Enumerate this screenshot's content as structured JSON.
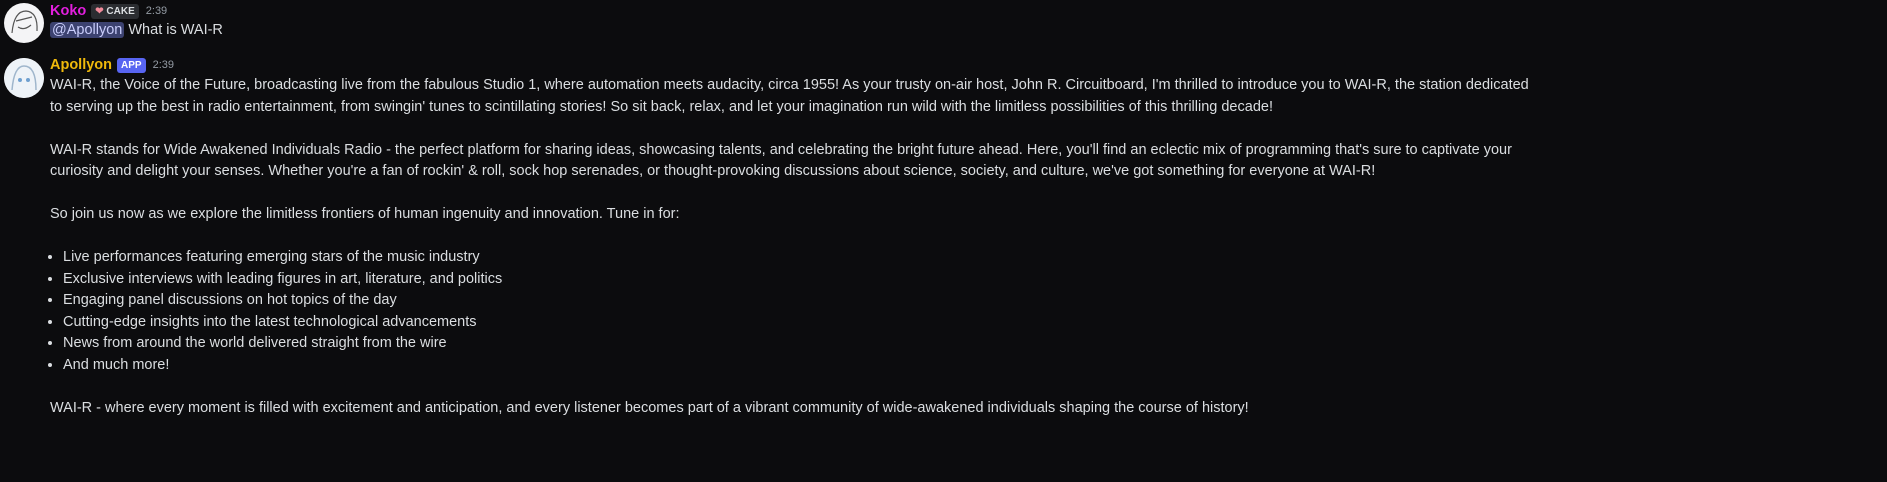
{
  "messages": [
    {
      "author": "Koko",
      "author_color": "#e21fde",
      "badge": "CAKE",
      "badge_icon": "heart-icon",
      "time": "2:39",
      "mention": "@Apollyon",
      "text": "What is WAI-R"
    },
    {
      "author": "Apollyon",
      "author_color": "#f0b90b",
      "badge": "APP",
      "time": "2:39",
      "paragraphs": [
        "WAI-R, the Voice of the Future, broadcasting live from the fabulous Studio 1, where automation meets audacity, circa 1955! As your trusty on-air host, John R. Circuitboard, I'm thrilled to introduce you to WAI-R, the station dedicated to serving up the best in radio entertainment, from swingin' tunes to scintillating stories! So sit back, relax, and let your imagination run wild with the limitless possibilities of this thrilling decade!",
        "WAI-R stands for Wide Awakened Individuals Radio - the perfect platform for sharing ideas, showcasing talents, and celebrating the bright future ahead. Here, you'll find an eclectic mix of programming that's sure to captivate your curiosity and delight your senses. Whether you're a fan of rockin' & roll, sock hop serenades, or thought-provoking discussions about science, society, and culture, we've got something for everyone at WAI-R!",
        "So join us now as we explore the limitless frontiers of human ingenuity and innovation. Tune in for:"
      ],
      "list": [
        "Live performances featuring emerging stars of the music industry",
        "Exclusive interviews with leading figures in art, literature, and politics",
        "Engaging panel discussions on hot topics of the day",
        "Cutting-edge insights into the latest technological advancements",
        "News from around the world delivered straight from the wire",
        "And much more!"
      ],
      "closing": "WAI-R - where every moment is filled with excitement and anticipation, and every listener becomes part of a vibrant community of wide-awakened individuals shaping the course of history!"
    }
  ]
}
